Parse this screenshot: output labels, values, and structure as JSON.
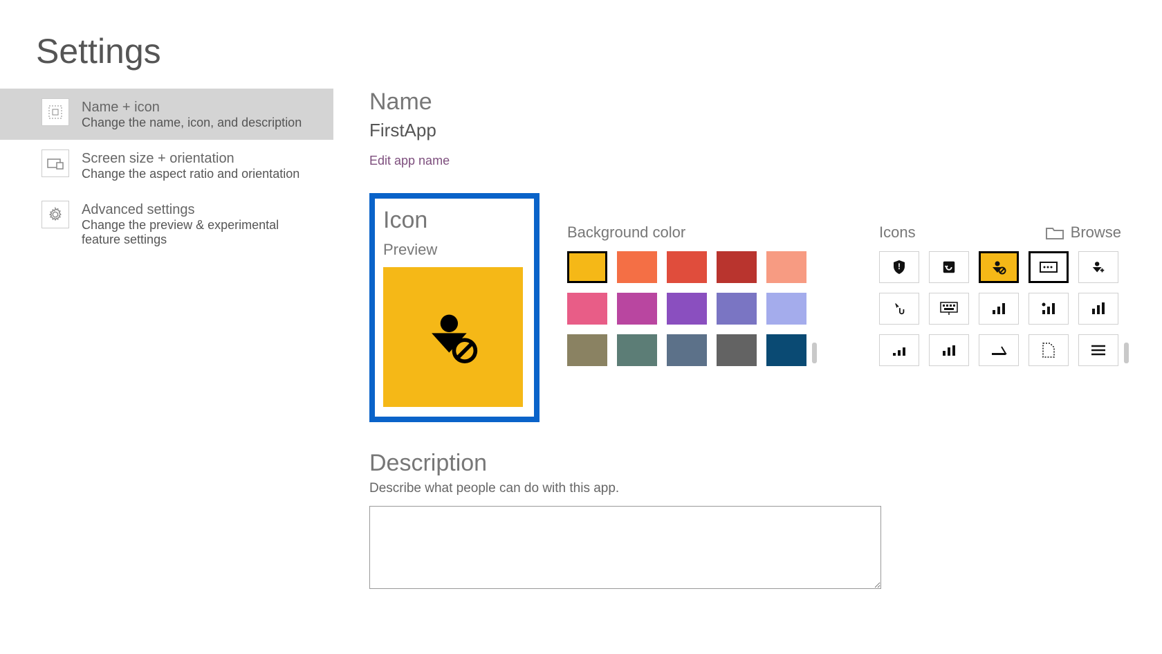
{
  "page_title": "Settings",
  "sidebar": {
    "items": [
      {
        "title": "Name + icon",
        "desc": "Change the name, icon, and description",
        "icon": "grid-icon",
        "active": true
      },
      {
        "title": "Screen size + orientation",
        "desc": "Change the aspect ratio and orientation",
        "icon": "screen-icon",
        "active": false
      },
      {
        "title": "Advanced settings",
        "desc": "Change the preview & experimental feature settings",
        "icon": "gear-icon",
        "active": false
      }
    ]
  },
  "main": {
    "name_heading": "Name",
    "app_name": "FirstApp",
    "edit_link": "Edit app name",
    "icon_heading": "Icon",
    "preview_label": "Preview",
    "bgcolor_label": "Background color",
    "icons_label": "Icons",
    "browse_label": "Browse",
    "description_heading": "Description",
    "description_hint": "Describe what people can do with this app.",
    "description_value": "",
    "selected_color": "#f5b817",
    "colors": [
      "#f5b817",
      "#f46f45",
      "#e04d3c",
      "#b9342e",
      "#f79b82",
      "#e85d87",
      "#b946a0",
      "#8a4fbf",
      "#7a75c3",
      "#a4acec",
      "#8a8262",
      "#5c7d76",
      "#5c7189",
      "#636363",
      "#0a4a73"
    ],
    "icons": [
      {
        "name": "shield-icon"
      },
      {
        "name": "refresh-icon"
      },
      {
        "name": "user-block-icon",
        "selected": true
      },
      {
        "name": "card-icon",
        "outlined": true
      },
      {
        "name": "user-add-icon"
      },
      {
        "name": "cursor-hand-icon"
      },
      {
        "name": "keyboard-icon"
      },
      {
        "name": "bars-icon"
      },
      {
        "name": "bars-dot-icon"
      },
      {
        "name": "bars-tall-icon"
      },
      {
        "name": "bars-short-icon"
      },
      {
        "name": "bars-med-icon"
      },
      {
        "name": "scanner-icon"
      },
      {
        "name": "page-dashed-icon"
      },
      {
        "name": "menu-lines-icon"
      }
    ]
  }
}
